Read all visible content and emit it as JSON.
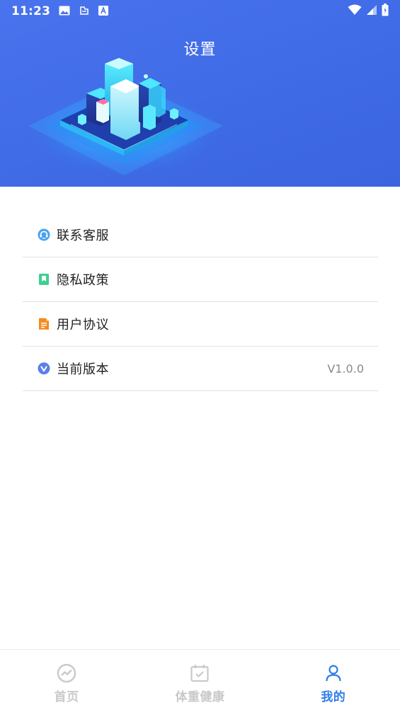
{
  "status_bar": {
    "time": "11:23",
    "notification_icons": [
      "image-icon",
      "cloud-icon",
      "app-a-icon"
    ],
    "system_icons": [
      "wifi-icon",
      "signal-icon",
      "battery-icon"
    ]
  },
  "header": {
    "title": "设置",
    "background_color": "#4570ea"
  },
  "menu": {
    "items": [
      {
        "label": "联系客服",
        "icon": "customer-service-icon",
        "icon_color": "#4aa3f0",
        "value": ""
      },
      {
        "label": "隐私政策",
        "icon": "privacy-bookmark-icon",
        "icon_color": "#3ecf8e",
        "value": ""
      },
      {
        "label": "用户协议",
        "icon": "document-icon",
        "icon_color": "#f58a1f",
        "value": ""
      },
      {
        "label": "当前版本",
        "icon": "version-v-icon",
        "icon_color": "#5b7fe8",
        "value": "V1.0.0"
      }
    ]
  },
  "tabbar": {
    "active_color": "#2f7de9",
    "inactive_color": "#c9c9c9",
    "tabs": [
      {
        "label": "首页",
        "icon": "home-chart-icon",
        "active": false
      },
      {
        "label": "体重健康",
        "icon": "calendar-check-icon",
        "active": false
      },
      {
        "label": "我的",
        "icon": "user-icon",
        "active": true
      }
    ]
  }
}
